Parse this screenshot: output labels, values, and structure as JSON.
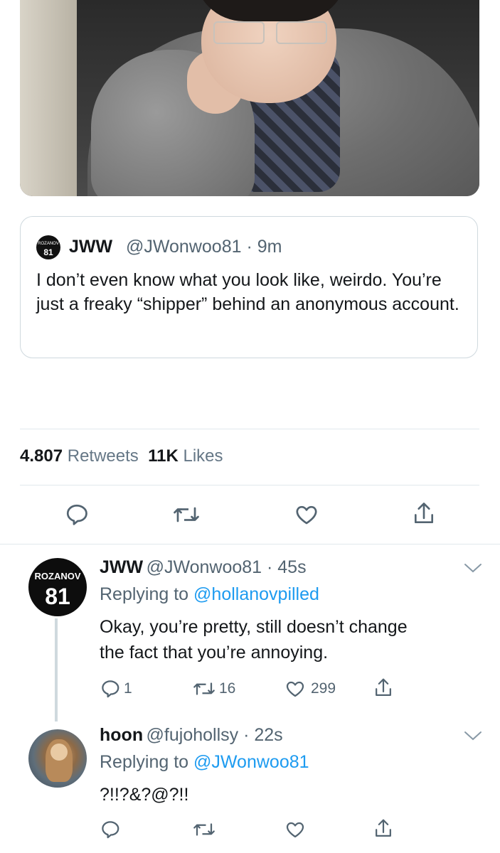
{
  "quoted_tweet": {
    "name": "JWW",
    "handle": "@JWonwoo81",
    "time": "9m",
    "text": "I don’t even know what you look like, weirdo. You’re just a freaky “shipper” behind an anonymous account."
  },
  "stats": {
    "retweets_count": "4.807",
    "retweets_label": "Retweets",
    "likes_count": "11K",
    "likes_label": "Likes"
  },
  "action_icons": [
    "reply-icon",
    "retweet-icon",
    "like-icon",
    "share-icon"
  ],
  "replies": [
    {
      "avatar_text_top": "ROZANOV",
      "avatar_text_number": "81",
      "name": "JWW",
      "handle": "@JWonwoo81",
      "time": "45s",
      "replying_prefix": "Replying to",
      "replying_to": "@hollanovpilled",
      "text_line1": "Okay, you’re pretty, still doesn’t change",
      "text_line2": "the fact that you’re annoying.",
      "reply_count": "1",
      "retweet_count": "16",
      "like_count": "299"
    },
    {
      "name": "hoon",
      "handle": "@fujohollsy",
      "time": "22s",
      "replying_prefix": "Replying to",
      "replying_to": "@JWonwoo81",
      "text": "?!!?&?@?!!"
    }
  ],
  "colors": {
    "link": "#1d9bf0",
    "secondary_text": "#536471",
    "icon": "#536471",
    "divider": "#e1e8ed"
  }
}
